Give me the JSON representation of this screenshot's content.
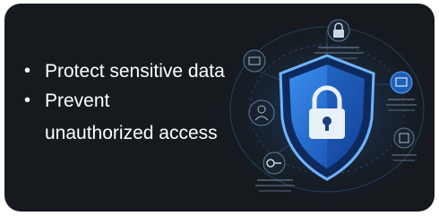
{
  "bullets": [
    {
      "text": "Protect sensitive data"
    },
    {
      "line1": "Prevent",
      "line2": "unauthorized access"
    }
  ],
  "icons": [
    "shield-lock-icon",
    "padlock-icon",
    "key-icon",
    "network-icon"
  ],
  "colors": {
    "card_background": "#161a1f",
    "shield_blue": "#1e6ee0",
    "glow_blue": "#3aa0ff",
    "text": "#ffffff"
  }
}
